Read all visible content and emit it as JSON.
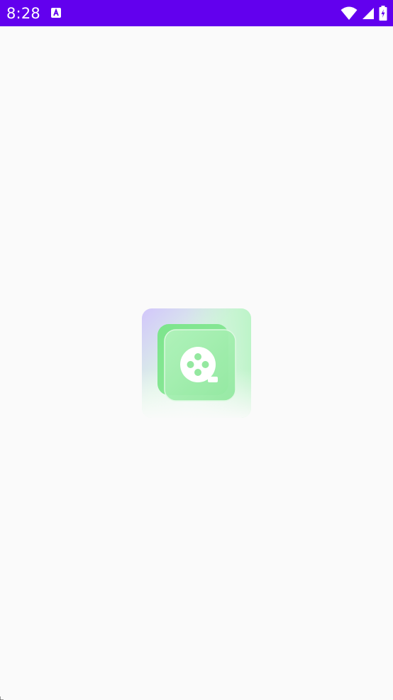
{
  "status_bar": {
    "time": "8:28",
    "color": "#6200ee",
    "icons": [
      "notification-a-icon",
      "wifi-icon",
      "signal-icon",
      "battery-charging-icon"
    ]
  },
  "splash": {
    "background": "#fafafa",
    "logo_icon": "video-reel-icon",
    "logo_colors": [
      "#c9c2fb",
      "#8ee89a",
      "#ffffff"
    ]
  }
}
